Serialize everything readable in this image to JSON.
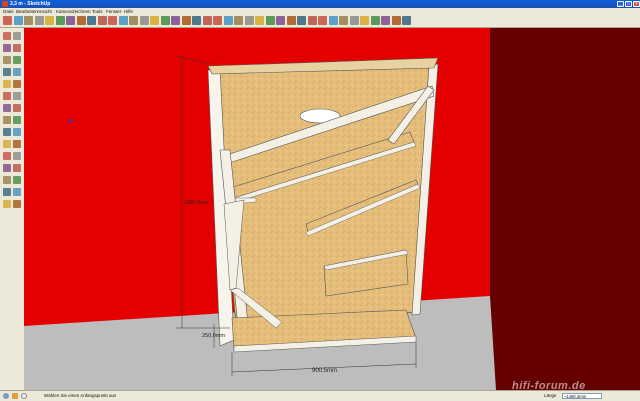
{
  "window": {
    "title": "3,3 m - SketchUp",
    "controls": {
      "minimize": "_",
      "maximize": "□",
      "close": "×"
    }
  },
  "menubar": {
    "items": [
      "Datei",
      "Bearbeiten",
      "Ansicht",
      "Kamera",
      "Zeichnen",
      "Tools",
      "Fenster",
      "Hilfe"
    ]
  },
  "toolbar": {
    "icons": [
      "select-icon",
      "eraser-icon",
      "pencil-icon",
      "line-icon",
      "rectangle-icon",
      "circle-icon",
      "polygon-icon",
      "arc-icon",
      "freehand-icon",
      "push-pull-icon",
      "follow-me-icon",
      "offset-icon",
      "move-icon",
      "rotate-icon",
      "scale-icon",
      "tape-icon",
      "dimension-icon",
      "protractor-icon",
      "text-icon",
      "axes-icon",
      "3d-text-icon",
      "orbit-icon",
      "pan-icon",
      "zoom-icon",
      "zoom-window-icon",
      "zoom-extents-icon",
      "previous-view-icon",
      "next-view-icon",
      "iso-view-icon",
      "top-view-icon",
      "front-view-icon",
      "right-view-icon",
      "back-view-icon",
      "left-view-icon",
      "xray-icon",
      "wireframe-icon",
      "hidden-line-icon",
      "shaded-icon",
      "textured-icon"
    ]
  },
  "left_toolbar": {
    "icons": [
      "select-icon",
      "eraser-icon",
      "rectangle-icon",
      "line-icon",
      "circle-icon",
      "arc-icon",
      "polygon-icon",
      "freehand-icon",
      "move-icon",
      "push-pull-icon",
      "rotate-icon",
      "follow-me-icon",
      "scale-icon",
      "offset-icon",
      "tape-icon",
      "dimension-icon",
      "protractor-icon",
      "text-icon",
      "axes-icon",
      "3d-text-icon",
      "paint-bucket-icon",
      "orbit-icon",
      "pan-icon",
      "zoom-icon",
      "zoom-window-icon",
      "zoom-extents-icon",
      "walk-icon",
      "look-around-icon",
      "section-plane-icon",
      "position-camera-icon"
    ]
  },
  "viewport": {
    "dimensions": {
      "height_label": "1000,0mm",
      "bottom_label": "250,0mm",
      "width_label": "900,5mm"
    },
    "colors": {
      "left_wall": "#e50000",
      "right_wall": "#640000",
      "floor": "#c0c0c0",
      "wood": "#e6bf7c",
      "edge": "#ffffff"
    }
  },
  "statusbar": {
    "hint": "Wählen Sie einen Anfangspunkt aus",
    "length_label": "Länge",
    "length_value": "~1480,3mm"
  },
  "watermark": "hifi-forum.de"
}
